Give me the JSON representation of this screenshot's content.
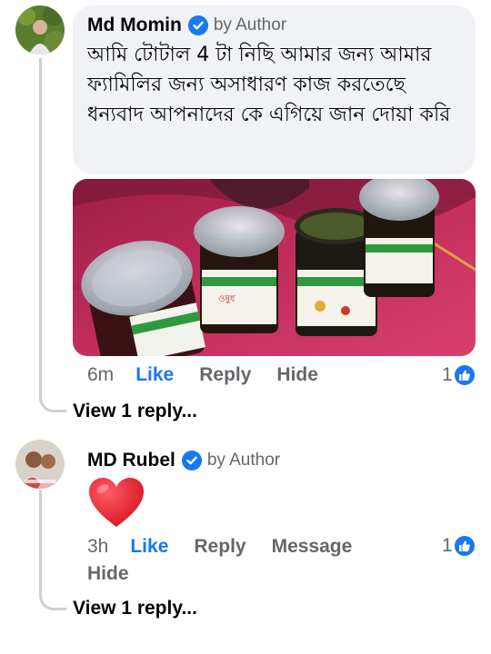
{
  "comments": [
    {
      "author": "Md Momin",
      "badge_label": "by Author",
      "text": "আমি টোটাল 4 টা নিছি আমার জন্য আমার ফ্যামিলির জন্য অসাধারণ কাজ করতেছে ধন্যবাদ আপনাদের কে এগিয়ে জান দোয়া করি",
      "time": "6m",
      "like_label": "Like",
      "reply_label": "Reply",
      "hide_label": "Hide",
      "reaction_count": "1",
      "view_replies": "View 1 reply...",
      "attachment_icon": "photo-of-jars"
    },
    {
      "author": "MD Rubel",
      "badge_label": "by Author",
      "text_icon": "red-heart-emoji",
      "time": "3h",
      "like_label": "Like",
      "reply_label": "Reply",
      "message_label": "Message",
      "hide_label": "Hide",
      "reaction_count": "1",
      "view_replies": "View 1 reply..."
    }
  ],
  "colors": {
    "accent": "#1877f2",
    "bubble_bg": "#f0f2f5",
    "secondary_text": "#65676b",
    "thread_line": "#ccd0d5",
    "heart": "#e0202e"
  }
}
